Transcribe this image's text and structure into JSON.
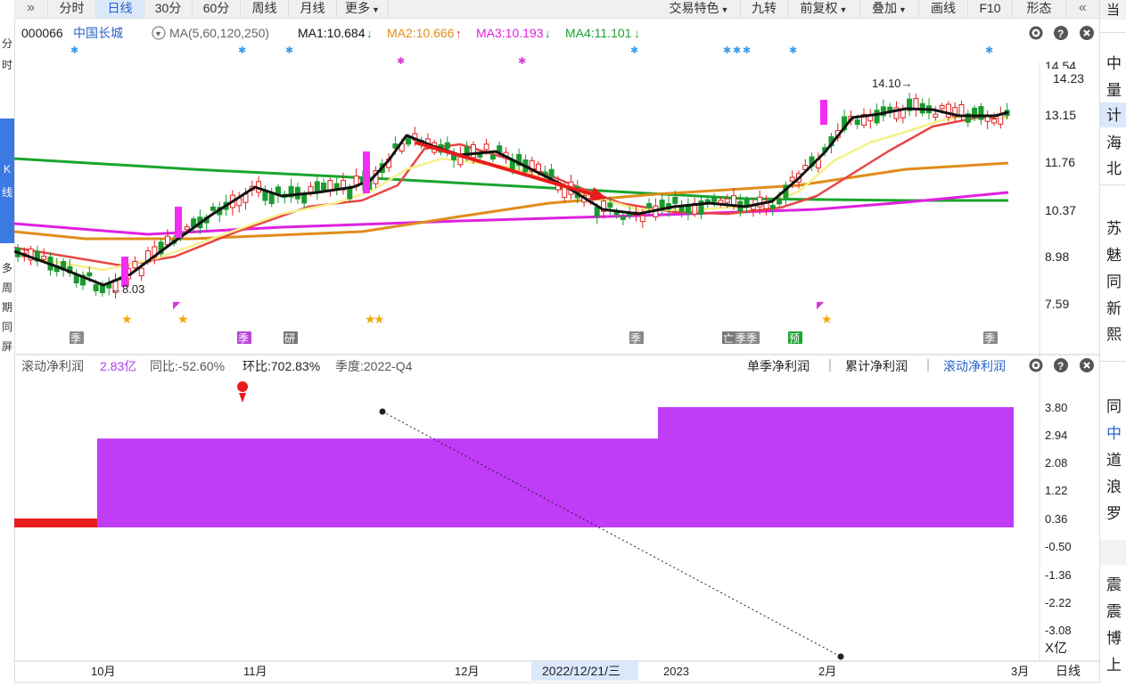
{
  "toolbar": {
    "tabs": [
      "分时",
      "日线",
      "30分",
      "60分",
      "周线",
      "月线"
    ],
    "active": "日线",
    "more": "更多",
    "right": [
      "交易特色",
      "九转",
      "前复权",
      "叠加",
      "画线",
      "F10",
      "形态"
    ]
  },
  "left_strip": {
    "top": [
      "分",
      "时"
    ],
    "blue_tab": [
      "K",
      "线"
    ],
    "bottom": [
      "多",
      "周",
      "期",
      "同",
      "屏"
    ]
  },
  "stock": {
    "code": "000066",
    "name": "中国长城",
    "ma_setting": "MA(5,60,120,250)",
    "ma": [
      {
        "label": "MA1:10.684",
        "dir": "down",
        "color": "#111111"
      },
      {
        "label": "MA2:10.666",
        "dir": "up",
        "color": "#e08c1a"
      },
      {
        "label": "MA3:10.193",
        "dir": "down",
        "color": "#e020e0"
      },
      {
        "label": "MA4:11.101",
        "dir": "down",
        "color": "#19a32f"
      }
    ]
  },
  "price_axis": [
    "14.54",
    "13.15",
    "11.76",
    "10.37",
    "8.98",
    "7.59"
  ],
  "current_price": "14.23",
  "annotations": {
    "high": "14.10",
    "low": "8.03"
  },
  "event_tags": [
    "季",
    "季",
    "研",
    "季",
    "亡",
    "季",
    "季",
    "预",
    "季"
  ],
  "bottom_panel": {
    "indicator": "滚动净利润",
    "value": "2.83亿",
    "yoy": "同比:-52.60%",
    "qoq": "环比:702.83%",
    "quarter": "季度:2022-Q4",
    "tabs": [
      "单季净利润",
      "累计净利润",
      "滚动净利润"
    ],
    "active_tab": "滚动净利润",
    "axis": [
      "3.80",
      "2.94",
      "2.08",
      "1.22",
      "0.36",
      "-0.50",
      "-1.36",
      "-2.22",
      "-3.08"
    ],
    "unit": "X亿"
  },
  "chart_data": {
    "type": "bar",
    "title": "滚动净利润",
    "series": [
      {
        "name": "滚动净利润",
        "segments": [
          {
            "from": "2022-09-23",
            "to": "2022-09-30",
            "value": 0.36,
            "color": "#e81c1c"
          },
          {
            "from": "2022-09-30",
            "to": "2023-01-03",
            "value": 2.83,
            "color": "#c03cf7"
          },
          {
            "from": "2023-01-03",
            "to": "2023-03-06",
            "value": 3.8,
            "color": "#c03cf7"
          }
        ]
      }
    ],
    "ylim": [
      -3.5,
      4.2
    ],
    "unit": "亿"
  },
  "time_axis": [
    "10月",
    "11月",
    "12月",
    "2023",
    "2月",
    "3月"
  ],
  "cursor_date": "2022/12/21/三",
  "period_label": "日线",
  "right_panel": {
    "rows1": [
      "当",
      "中",
      "量",
      "计",
      "海",
      "北"
    ],
    "rows2": [
      "苏",
      "魅",
      "同",
      "新",
      "熙"
    ],
    "rows3": [
      "同",
      "中",
      "道",
      "浪",
      "罗"
    ],
    "rows4": [
      "震",
      "震",
      "博",
      "上"
    ]
  }
}
